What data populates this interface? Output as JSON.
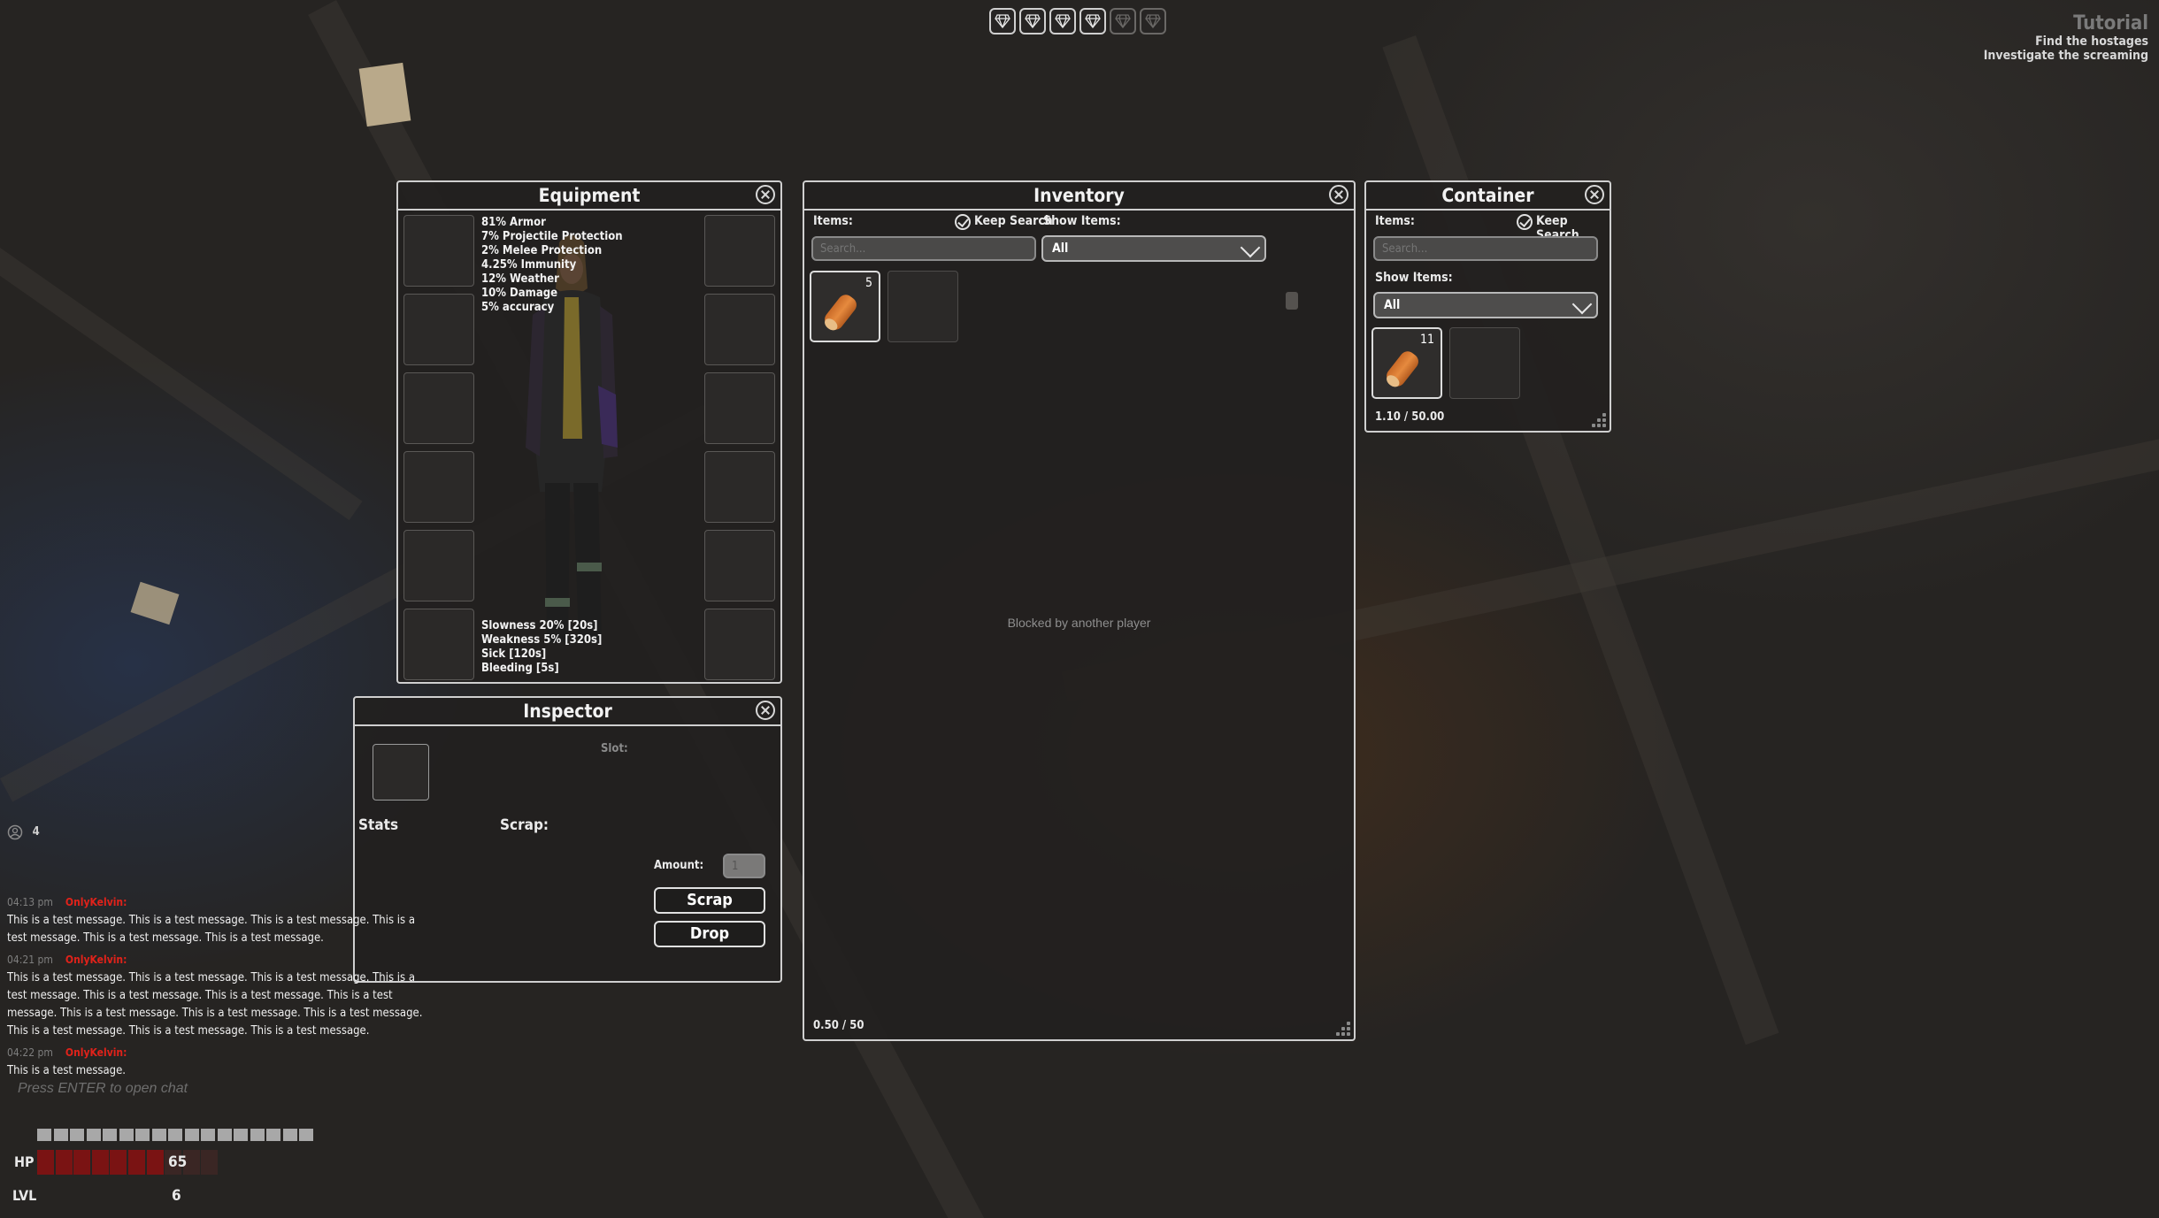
{
  "objectives": {
    "title": "Tutorial",
    "items": [
      "Find the hostages",
      "Investigate the screaming"
    ]
  },
  "gems": {
    "filled": 4,
    "total": 6
  },
  "equipment": {
    "title": "Equipment",
    "stats": [
      "81% Armor",
      "7% Projectile Protection",
      "2% Melee Protection",
      "4.25% Immunity",
      "12% Weather",
      "10% Damage",
      "5% accuracy"
    ],
    "effects": [
      "Slowness 20% [20s]",
      "Weakness 5% [320s]",
      "Sick [120s]",
      "Bleeding [5s]"
    ]
  },
  "inspector": {
    "title": "Inspector",
    "slot_label": "Slot:",
    "stats_label": "Stats",
    "scrap_label": "Scrap:",
    "amount_label": "Amount:",
    "amount_value": "1",
    "scrap_button": "Scrap",
    "drop_button": "Drop"
  },
  "inventory": {
    "title": "Inventory",
    "items_label": "Items:",
    "keep_search": "Keep Search",
    "show_items_label": "Show Items:",
    "search_placeholder": "Search...",
    "filter": "All",
    "item_count": "5",
    "blocked_text": "Blocked by another player",
    "weight": "0.50 / 50"
  },
  "container": {
    "title": "Container",
    "items_label": "Items:",
    "keep_search": "Keep Search",
    "show_items_label": "Show Items:",
    "search_placeholder": "Search...",
    "filter": "All",
    "item_count": "11",
    "weight": "1.10 / 50.00"
  },
  "players_online": "4",
  "chat": {
    "messages": [
      {
        "time": "04:13 pm",
        "name": "OnlyKelvin:",
        "text": "This is a test message. This is a test message. This is a test message. This is a test message. This is a test message. This is a test message."
      },
      {
        "time": "04:21 pm",
        "name": "OnlyKelvin:",
        "text": "This is a test message. This is a test message. This is a test message. This is a test message. This is a test message. This is a test message. This is a test message. This is a test message. This is a test message. This is a test message. This is a test message. This is a test message. This is a test message."
      },
      {
        "time": "04:22 pm",
        "name": "OnlyKelvin:",
        "text": "This is a test message."
      }
    ],
    "prompt": "Press ENTER to open chat"
  },
  "hud": {
    "hp_label": "HP",
    "hp_value": "65",
    "hp_fraction": 0.65,
    "lvl_label": "LVL",
    "lvl_value": "6",
    "colors": {
      "hp": "#7a1313",
      "accent": "#e0221a"
    }
  }
}
